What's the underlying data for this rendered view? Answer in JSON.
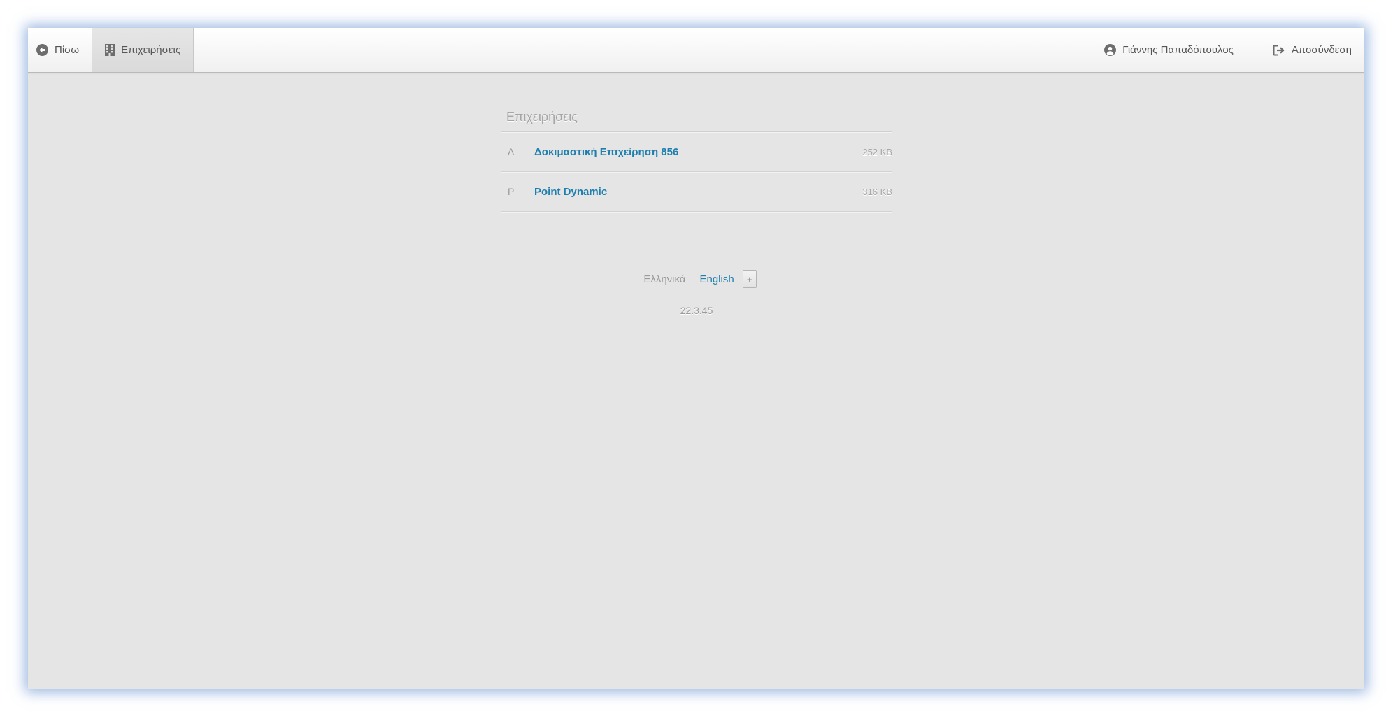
{
  "topbar": {
    "back_label": "Πίσω",
    "businesses_label": "Επιχειρήσεις",
    "user_name": "Γιάννης Παπαδόπουλος",
    "logout_label": "Αποσύνδεση"
  },
  "businesses": {
    "title": "Επιχειρήσεις",
    "items": [
      {
        "initial": "Δ",
        "name": "Δοκιμαστική Επιχείρηση 856",
        "size": "252 KB"
      },
      {
        "initial": "P",
        "name": "Point Dynamic",
        "size": "316 KB"
      }
    ]
  },
  "languages": {
    "current": "Ελληνικά",
    "other": "English",
    "add_label": "+"
  },
  "version": "22.3.45",
  "colors": {
    "link": "#1d7fae",
    "background": "#e5e5e5",
    "muted": "#9a9a9a"
  },
  "icons": {
    "back": "circle-arrow-left-icon",
    "businesses": "building-icon",
    "user": "user-circle-icon",
    "logout": "sign-out-icon"
  }
}
